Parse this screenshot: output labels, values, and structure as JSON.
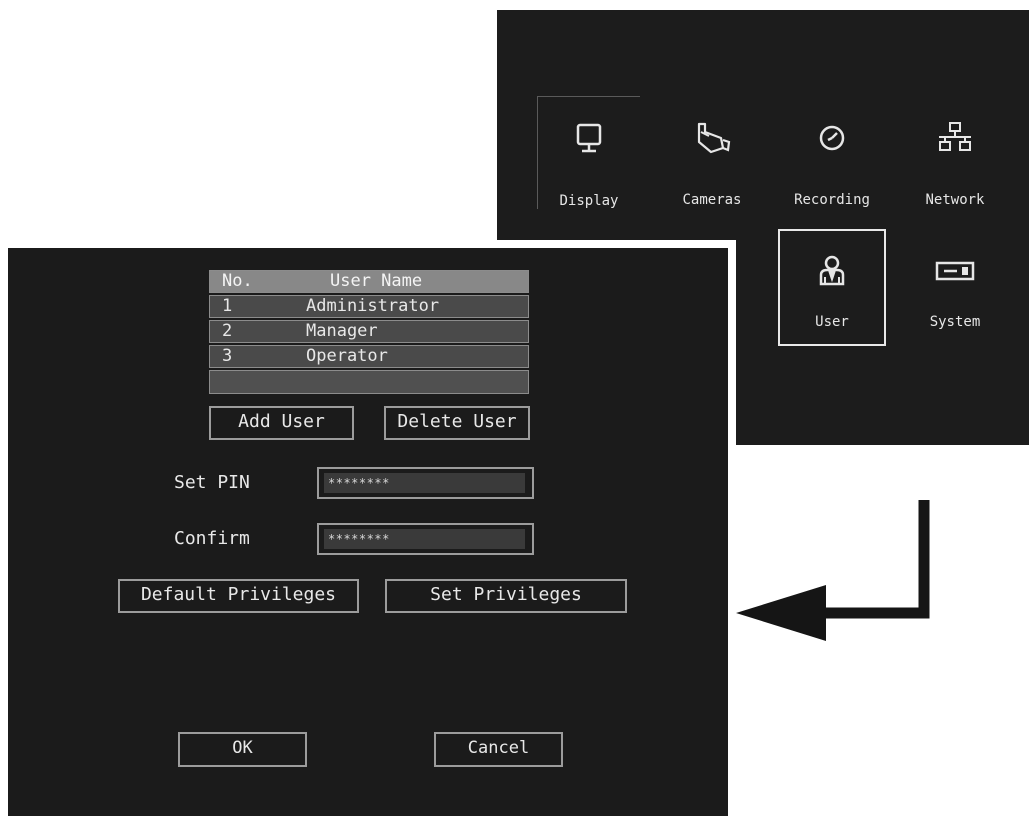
{
  "main_menu": {
    "items": [
      {
        "label": "Display",
        "icon": "monitor-icon"
      },
      {
        "label": "Cameras",
        "icon": "camera-icon"
      },
      {
        "label": "Recording",
        "icon": "clock-icon"
      },
      {
        "label": "Network",
        "icon": "network-icon"
      },
      {
        "label": "User",
        "icon": "user-icon",
        "selected": true
      },
      {
        "label": "System",
        "icon": "system-device-icon"
      }
    ]
  },
  "user_dialog": {
    "table": {
      "headers": {
        "no": "No.",
        "name": "User Name"
      },
      "rows": [
        {
          "no": "1",
          "name": "Administrator"
        },
        {
          "no": "2",
          "name": "Manager"
        },
        {
          "no": "3",
          "name": "Operator"
        }
      ]
    },
    "add_user_label": "Add User",
    "delete_user_label": "Delete User",
    "set_pin_label": "Set PIN",
    "set_pin_value": "********",
    "confirm_label": "Confirm",
    "confirm_value": "********",
    "default_privileges_label": "Default Privileges",
    "set_privileges_label": "Set Privileges",
    "ok_label": "OK",
    "cancel_label": "Cancel"
  },
  "colors": {
    "background": "#1b1b1b",
    "text": "#e8e8e8",
    "border": "#9c9c9c",
    "table_header": "#888888",
    "table_row": "#4a4a4a"
  }
}
